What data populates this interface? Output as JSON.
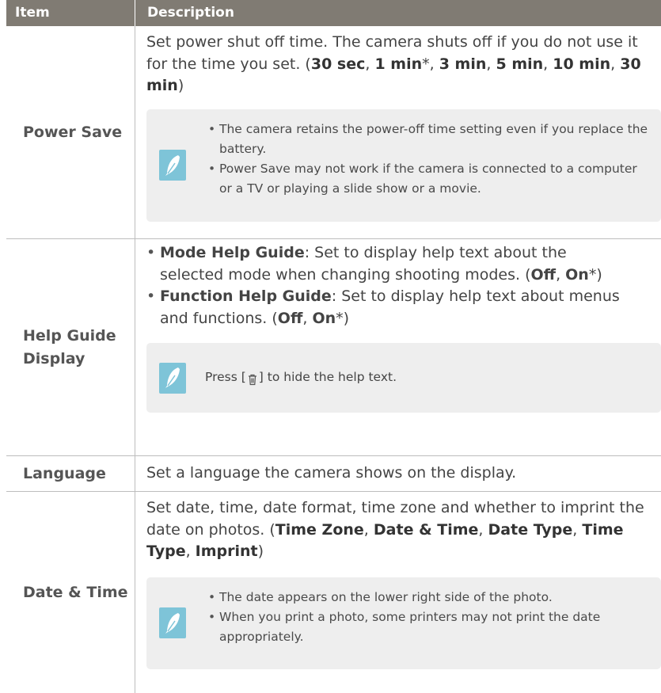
{
  "header": {
    "item": "Item",
    "description": "Description"
  },
  "power_save": {
    "item": "Power Save",
    "desc_prefix": "Set power shut off time. The camera shuts off if you do not use it for the time you set. (",
    "opt1": "30 sec",
    "sep1": ", ",
    "opt2": "1 min",
    "star1": "*",
    "sep2": ", ",
    "opt3": "3 min",
    "sep3": ", ",
    "opt4": "5 min",
    "sep4": ", ",
    "opt5": "10 min",
    "sep5": ", ",
    "opt6": "30 min",
    "close": ")",
    "note": [
      "The camera retains the power-off time setting even if you replace the battery.",
      "Power Save may not work if the camera is connected to a computer or a TV or playing a slide show or a movie."
    ]
  },
  "help_guide": {
    "item": "Help Guide Display",
    "b1_name": "Mode Help Guide",
    "b1_text": ": Set to display help text about the selected mode when changing shooting modes. (",
    "b1_off": "Off",
    "b1_sep": ", ",
    "b1_on": "On",
    "b1_end": "*)",
    "b2_name": "Function Help Guide",
    "b2_text": ": Set to display help text about menus and functions. (",
    "b2_off": "Off",
    "b2_sep": ", ",
    "b2_on": "On",
    "b2_end": "*)",
    "note_prefix": "Press [",
    "note_icon": "trash-icon",
    "note_suffix": "] to hide the help text."
  },
  "language": {
    "item": "Language",
    "desc": "Set a language the camera shows on the display."
  },
  "date_time": {
    "item": "Date & Time",
    "desc_prefix": "Set date, time, date format, time zone and whether to imprint the date on photos. (",
    "opt1": "Time Zone",
    "sep1": ", ",
    "opt2": "Date & Time",
    "sep2": ", ",
    "opt3": "Date Type",
    "sep3": ", ",
    "opt4": "Time Type",
    "sep4": ", ",
    "opt5": "Imprint",
    "close": ")",
    "note": [
      "The date appears on the lower right side of the photo.",
      "When you print a photo, some printers may not print the date appropriately."
    ]
  },
  "colors": {
    "header_bg": "#807b73",
    "note_bg": "#eeeeee",
    "note_icon": "#7ec4d8"
  }
}
